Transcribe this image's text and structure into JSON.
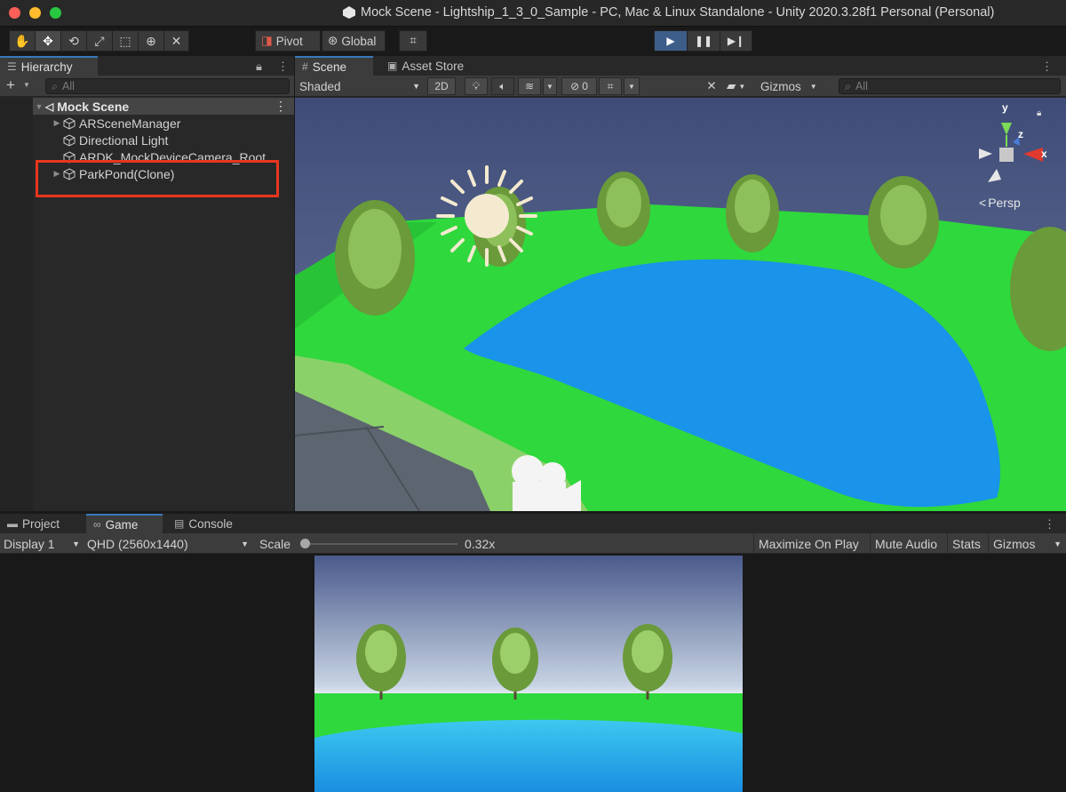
{
  "window": {
    "title": "Mock Scene - Lightship_1_3_0_Sample - PC, Mac & Linux Standalone - Unity 2020.3.28f1 Personal (Personal)"
  },
  "toolbar": {
    "tools": [
      "hand-tool-icon",
      "move-tool-icon",
      "rotate-tool-icon",
      "scale-tool-icon",
      "rect-tool-icon",
      "transform-tool-icon",
      "custom-tool-icon"
    ],
    "pivot_label": "Pivot",
    "global_label": "Global",
    "active_tool": "move-tool-icon"
  },
  "hierarchy": {
    "tab_label": "Hierarchy",
    "add_label": "+",
    "search_placeholder": "All",
    "scene_name": "Mock Scene",
    "items": [
      {
        "label": "ARSceneManager",
        "expandable": true
      },
      {
        "label": "Directional Light",
        "expandable": false
      },
      {
        "label": "ARDK_MockDeviceCamera_Root",
        "expandable": false
      },
      {
        "label": "ParkPond(Clone)",
        "expandable": true
      }
    ],
    "highlighted_item": "ParkPond(Clone)"
  },
  "scene": {
    "tabs": [
      {
        "label": "Scene",
        "icon": "grid-icon",
        "active": true
      },
      {
        "label": "Asset Store",
        "icon": "shopping-bag-icon",
        "active": false
      }
    ],
    "shading_mode": "Shaded",
    "mode_2d": "2D",
    "hidden_count": "0",
    "gizmos_label": "Gizmos",
    "search_placeholder": "All",
    "projection_label": "Persp",
    "gizmo_axes": {
      "x": "x",
      "y": "y",
      "z": "z"
    }
  },
  "game": {
    "tabs": [
      {
        "label": "Project",
        "icon": "folder-icon",
        "active": false
      },
      {
        "label": "Game",
        "icon": "gamepad-icon",
        "active": true
      },
      {
        "label": "Console",
        "icon": "console-icon",
        "active": false
      }
    ],
    "display": "Display 1",
    "resolution": "QHD (2560x1440)",
    "scale_label": "Scale",
    "scale_value": "0.32x",
    "scale_fraction": 0.0,
    "maximize_label": "Maximize On Play",
    "mute_label": "Mute Audio",
    "stats_label": "Stats",
    "gizmos_label": "Gizmos"
  },
  "colors": {
    "accent": "#3a79bb",
    "play_active": "#3e5e8a",
    "highlight": "#e8351e",
    "grass": "#2fd83c",
    "water": "#1a93ea",
    "sky_top": "#4a5a8c"
  }
}
